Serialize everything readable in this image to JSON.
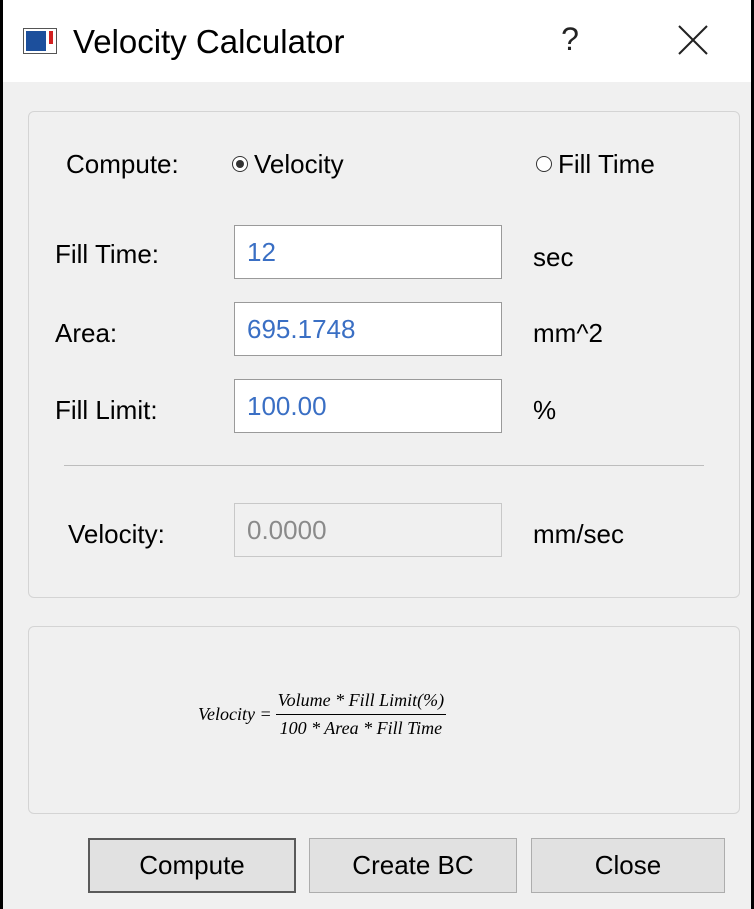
{
  "window": {
    "title": "Velocity Calculator",
    "help_label": "?",
    "close_icon": "close-icon",
    "app_icon": "velocity-calculator-app-icon"
  },
  "compute": {
    "label": "Compute:",
    "options": [
      {
        "label": "Velocity",
        "selected": true
      },
      {
        "label": "Fill Time",
        "selected": false
      }
    ]
  },
  "fields": {
    "fill_time": {
      "label": "Fill Time:",
      "value": "12",
      "unit": "sec"
    },
    "area": {
      "label": "Area:",
      "value": "695.1748",
      "unit": "mm^2"
    },
    "fill_limit": {
      "label": "Fill Limit:",
      "value": "100.00",
      "unit": "%"
    },
    "velocity": {
      "label": "Velocity:",
      "value": "0.0000",
      "unit": "mm/sec",
      "readonly": true
    }
  },
  "formula": {
    "lhs": "Velocity =",
    "numerator": "Volume * Fill Limit(%)",
    "denominator": "100 * Area * Fill Time"
  },
  "buttons": {
    "compute": "Compute",
    "create_bc": "Create BC",
    "close": "Close"
  },
  "colors": {
    "input_text": "#3a6fc4",
    "readonly_text": "#8a8a8a",
    "dialog_background": "#f0f0f0"
  }
}
